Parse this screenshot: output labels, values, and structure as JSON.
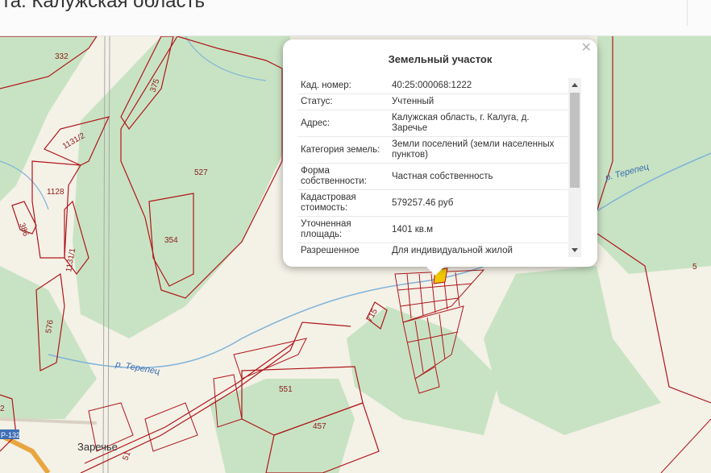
{
  "header": {
    "title": "та. Калужская область"
  },
  "map": {
    "parcel_labels": [
      "332",
      "375",
      "1131/2",
      "1128",
      "386",
      "527",
      "354",
      "1131/1",
      "576",
      "715",
      "551",
      "457",
      "5",
      "2",
      "51"
    ],
    "river_labels": [
      "р. Терепец",
      "р. Терепец"
    ],
    "place_label": "Заречье",
    "road_label": "Р-132",
    "colors": {
      "parcel_border": "#b0161b",
      "forest": "#c8e3c3",
      "land": "#f4f1e7",
      "river": "#7fb3d9",
      "selected": "#f0c800"
    }
  },
  "popup": {
    "title": "Земельный участок",
    "close_icon": "close-icon",
    "rows": [
      {
        "key": "Кад. номер:",
        "value": "40:25:000068:1222"
      },
      {
        "key": "Статус:",
        "value": "Учтенный"
      },
      {
        "key": "Адрес:",
        "value": "Калужская область, г. Калуга, д. Заречье"
      },
      {
        "key": "Категория земель:",
        "value": "Земли поселений (земли населенных пунктов)"
      },
      {
        "key": "Форма собственности:",
        "value": "Частная собственность"
      },
      {
        "key": "Кадастровая стоимость:",
        "value": "579257.46 руб"
      },
      {
        "key": "Уточненная площадь:",
        "value": "1401 кв.м"
      },
      {
        "key": "Разрешенное",
        "value": "Для индивидуальной жилой"
      }
    ]
  }
}
